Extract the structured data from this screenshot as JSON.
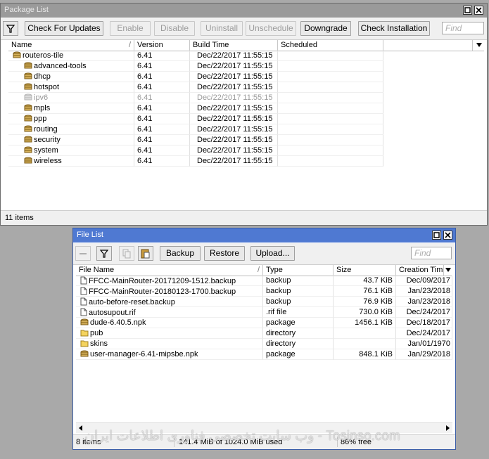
{
  "package_window": {
    "title": "Package List",
    "toolbar": {
      "check_updates": "Check For Updates",
      "enable": "Enable",
      "disable": "Disable",
      "uninstall": "Uninstall",
      "unschedule": "Unschedule",
      "downgrade": "Downgrade",
      "check_installation": "Check Installation",
      "find_placeholder": "Find"
    },
    "columns": [
      "Name",
      "Version",
      "Build Time",
      "Scheduled"
    ],
    "rows": [
      {
        "name": "routeros-tile",
        "version": "6.41",
        "build": "Dec/22/2017 11:55:15",
        "scheduled": ""
      },
      {
        "name": "advanced-tools",
        "version": "6.41",
        "build": "Dec/22/2017 11:55:15",
        "scheduled": ""
      },
      {
        "name": "dhcp",
        "version": "6.41",
        "build": "Dec/22/2017 11:55:15",
        "scheduled": ""
      },
      {
        "name": "hotspot",
        "version": "6.41",
        "build": "Dec/22/2017 11:55:15",
        "scheduled": ""
      },
      {
        "name": "ipv6",
        "version": "6.41",
        "build": "Dec/22/2017 11:55:15",
        "scheduled": ""
      },
      {
        "name": "mpls",
        "version": "6.41",
        "build": "Dec/22/2017 11:55:15",
        "scheduled": ""
      },
      {
        "name": "ppp",
        "version": "6.41",
        "build": "Dec/22/2017 11:55:15",
        "scheduled": ""
      },
      {
        "name": "routing",
        "version": "6.41",
        "build": "Dec/22/2017 11:55:15",
        "scheduled": ""
      },
      {
        "name": "security",
        "version": "6.41",
        "build": "Dec/22/2017 11:55:15",
        "scheduled": ""
      },
      {
        "name": "system",
        "version": "6.41",
        "build": "Dec/22/2017 11:55:15",
        "scheduled": ""
      },
      {
        "name": "wireless",
        "version": "6.41",
        "build": "Dec/22/2017 11:55:15",
        "scheduled": ""
      }
    ],
    "status": "11 items"
  },
  "file_window": {
    "title": "File List",
    "toolbar": {
      "backup": "Backup",
      "restore": "Restore",
      "upload": "Upload...",
      "find_placeholder": "Find"
    },
    "columns": [
      "File Name",
      "Type",
      "Size",
      "Creation Tim"
    ],
    "rows": [
      {
        "name": "FFCC-MainRouter-20171209-1512.backup",
        "type": "backup",
        "size": "43.7 KiB",
        "created": "Dec/09/2017",
        "icon": "file-icon"
      },
      {
        "name": "FFCC-MainRouter-20180123-1700.backup",
        "type": "backup",
        "size": "76.1 KiB",
        "created": "Jan/23/2018",
        "icon": "file-icon"
      },
      {
        "name": "auto-before-reset.backup",
        "type": "backup",
        "size": "76.9 KiB",
        "created": "Jan/23/2018",
        "icon": "file-icon"
      },
      {
        "name": "autosupout.rif",
        "type": ".rif file",
        "size": "730.0 KiB",
        "created": "Dec/24/2017",
        "icon": "file-icon"
      },
      {
        "name": "dude-6.40.5.npk",
        "type": "package",
        "size": "1456.1 KiB",
        "created": "Dec/18/2017",
        "icon": "package-icon"
      },
      {
        "name": "pub",
        "type": "directory",
        "size": "",
        "created": "Dec/24/2017",
        "icon": "folder-icon"
      },
      {
        "name": "skins",
        "type": "directory",
        "size": "",
        "created": "Jan/01/1970",
        "icon": "folder-icon"
      },
      {
        "name": "user-manager-6.41-mipsbe.npk",
        "type": "package",
        "size": "848.1 KiB",
        "created": "Jan/29/2018",
        "icon": "package-icon"
      }
    ],
    "status": {
      "items": "8 items",
      "space": "141.4 MiB of 1024.0 MiB used",
      "free": "86% free"
    }
  },
  "watermark": "وب سایت تخصصی فناوری اطلاعات ایران - Tosinso.com",
  "colors": {
    "active_title": "#4f79d2",
    "inactive_title": "#9a9a9a",
    "desktop": "#a9a9a9"
  }
}
